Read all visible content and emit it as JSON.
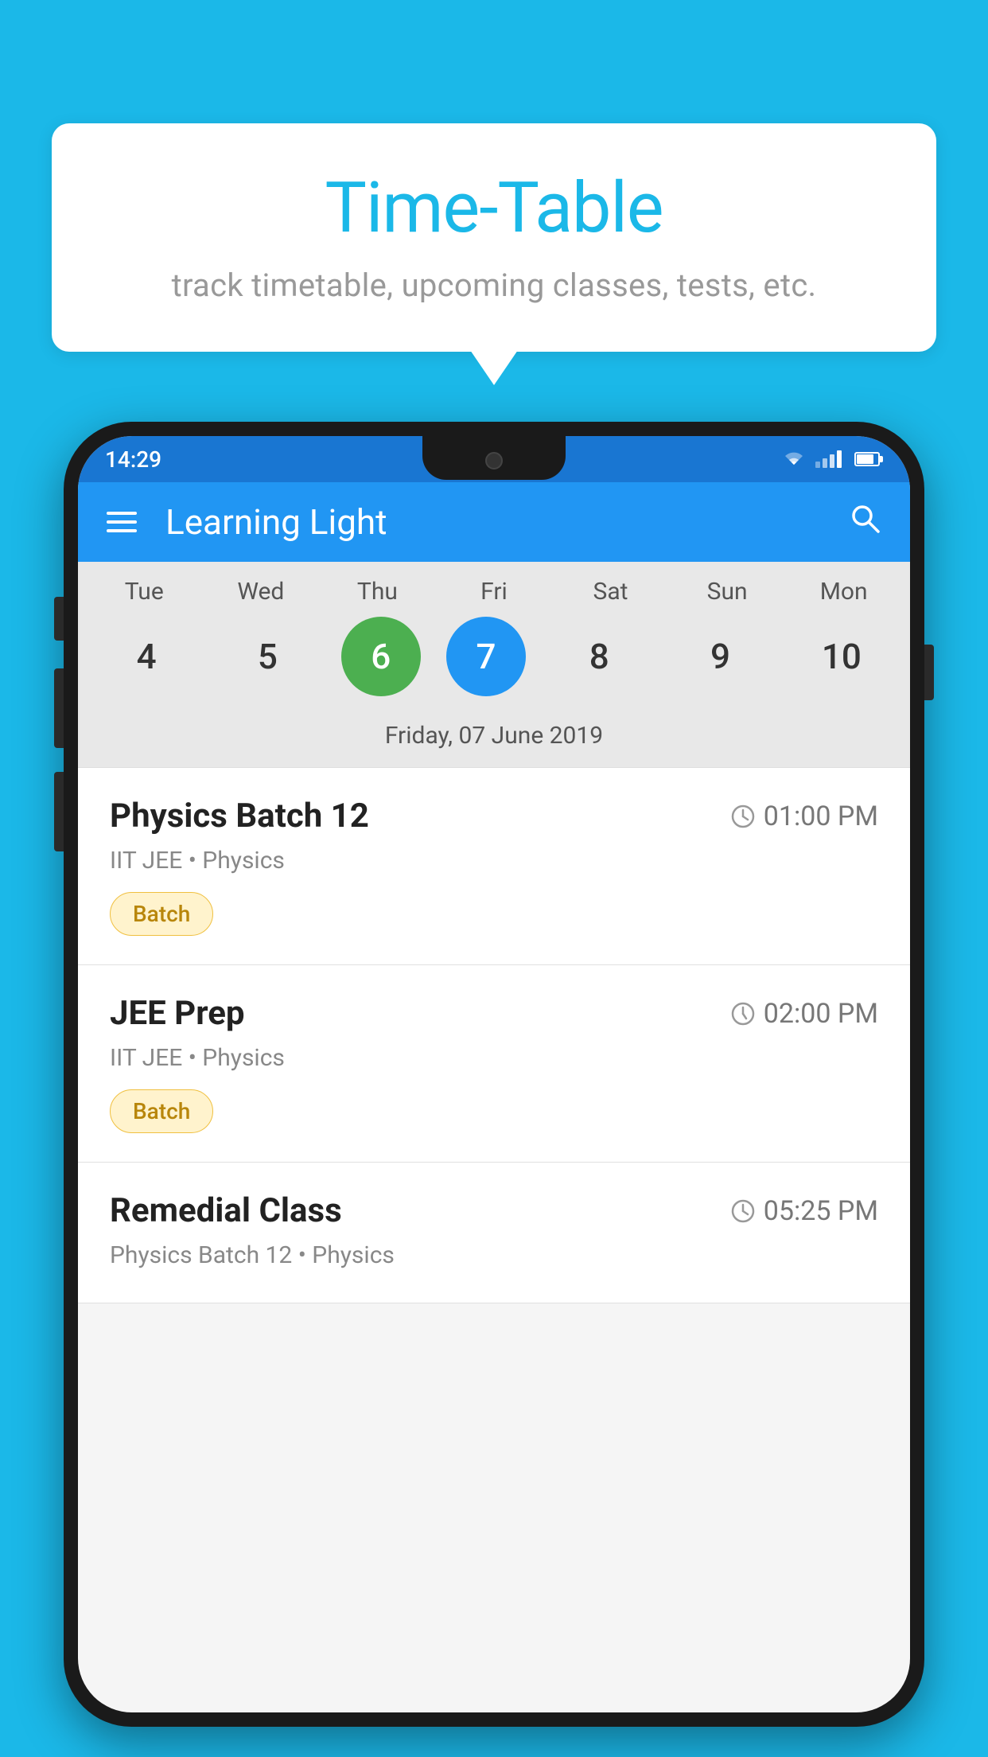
{
  "background_color": "#1BB8E8",
  "speech_bubble": {
    "title": "Time-Table",
    "subtitle": "track timetable, upcoming classes, tests, etc."
  },
  "status_bar": {
    "time": "14:29",
    "wifi": "▼▲",
    "battery_percent": 75
  },
  "app_bar": {
    "title": "Learning Light",
    "hamburger_label": "menu",
    "search_label": "search"
  },
  "calendar": {
    "days": [
      "Tue",
      "Wed",
      "Thu",
      "Fri",
      "Sat",
      "Sun",
      "Mon"
    ],
    "dates": [
      4,
      5,
      6,
      7,
      8,
      9,
      10
    ],
    "today_index": 2,
    "selected_index": 3,
    "selected_label": "Friday, 07 June 2019"
  },
  "schedule": [
    {
      "name": "Physics Batch 12",
      "time": "01:00 PM",
      "sub": "IIT JEE • Physics",
      "badge": "Batch"
    },
    {
      "name": "JEE Prep",
      "time": "02:00 PM",
      "sub": "IIT JEE • Physics",
      "badge": "Batch"
    },
    {
      "name": "Remedial Class",
      "time": "05:25 PM",
      "sub": "Physics Batch 12 • Physics",
      "badge": null
    }
  ]
}
